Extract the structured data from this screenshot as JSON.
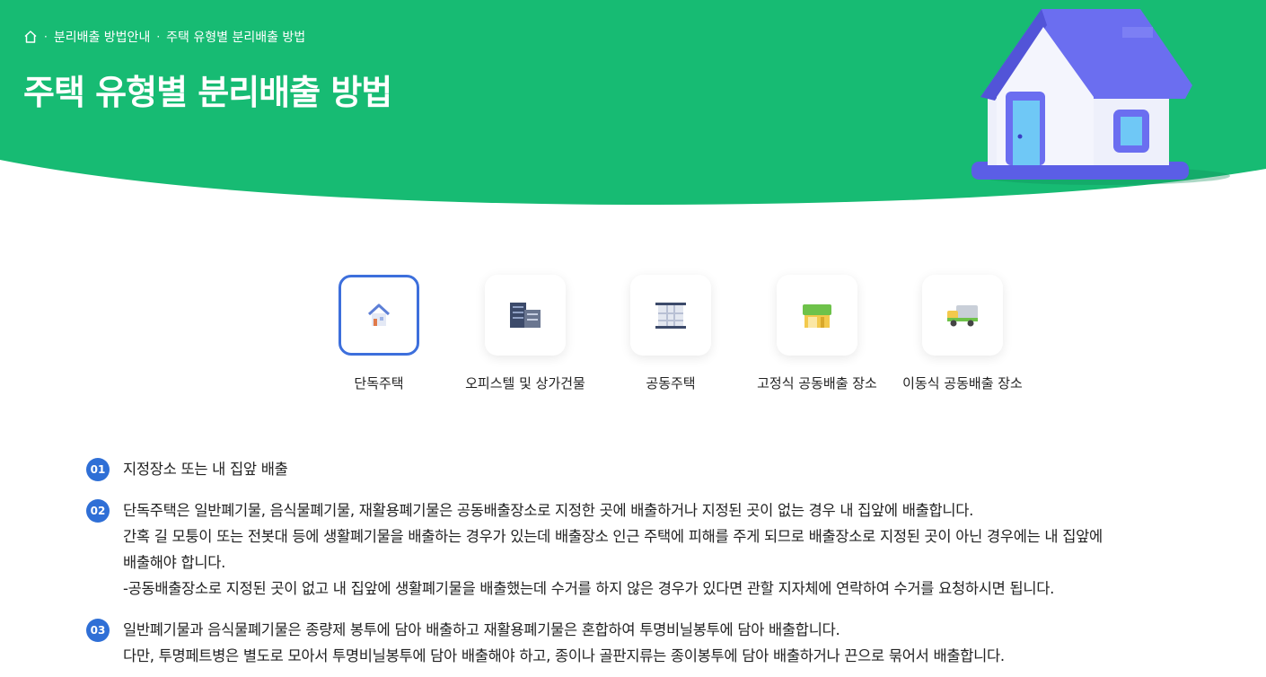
{
  "breadcrumb": {
    "items": [
      "분리배출 방법안내",
      "주택 유형별 분리배출 방법"
    ]
  },
  "page_title": "주택 유형별 분리배출 방법",
  "colors": {
    "hero_green": "#17bb73",
    "accent_blue": "#3d6fdc",
    "num_blue": "#2f6fd6"
  },
  "house_types": [
    {
      "label": "단독주택",
      "icon": "house-icon",
      "selected": true
    },
    {
      "label": "오피스텔 및 상가건물",
      "icon": "office-building-icon",
      "selected": false
    },
    {
      "label": "공동주택",
      "icon": "apartment-icon",
      "selected": false
    },
    {
      "label": "고정식 공동배출 장소",
      "icon": "fixed-collection-point-icon",
      "selected": false
    },
    {
      "label": "이동식 공동배출 장소",
      "icon": "mobile-truck-icon",
      "selected": false
    }
  ],
  "steps": [
    {
      "num": "01",
      "lines": [
        "지정장소 또는 내 집앞 배출"
      ]
    },
    {
      "num": "02",
      "lines": [
        "단독주택은 일반폐기물, 음식물폐기물, 재활용폐기물은 공동배출장소로 지정한 곳에 배출하거나 지정된 곳이 없는 경우 내 집앞에 배출합니다.",
        "간혹 길 모퉁이 또는 전봇대 등에 생활폐기물을 배출하는 경우가 있는데 배출장소 인근 주택에 피해를 주게 되므로 배출장소로 지정된 곳이 아닌 경우에는 내 집앞에",
        "배출해야 합니다.",
        "-공동배출장소로 지정된 곳이 없고 내 집앞에 생활폐기물을 배출했는데 수거를 하지 않은 경우가 있다면 관할 지자체에 연락하여 수거를 요청하시면 됩니다."
      ]
    },
    {
      "num": "03",
      "lines": [
        "일반폐기물과 음식물폐기물은 종량제 봉투에 담아 배출하고 재활용폐기물은 혼합하여 투명비닐봉투에 담아 배출합니다.",
        "다만, 투명페트병은 별도로 모아서 투명비닐봉투에 담아 배출해야 하고, 종이나 골판지류는 종이봉투에 담아 배출하거나 끈으로 묶어서 배출합니다."
      ]
    }
  ]
}
